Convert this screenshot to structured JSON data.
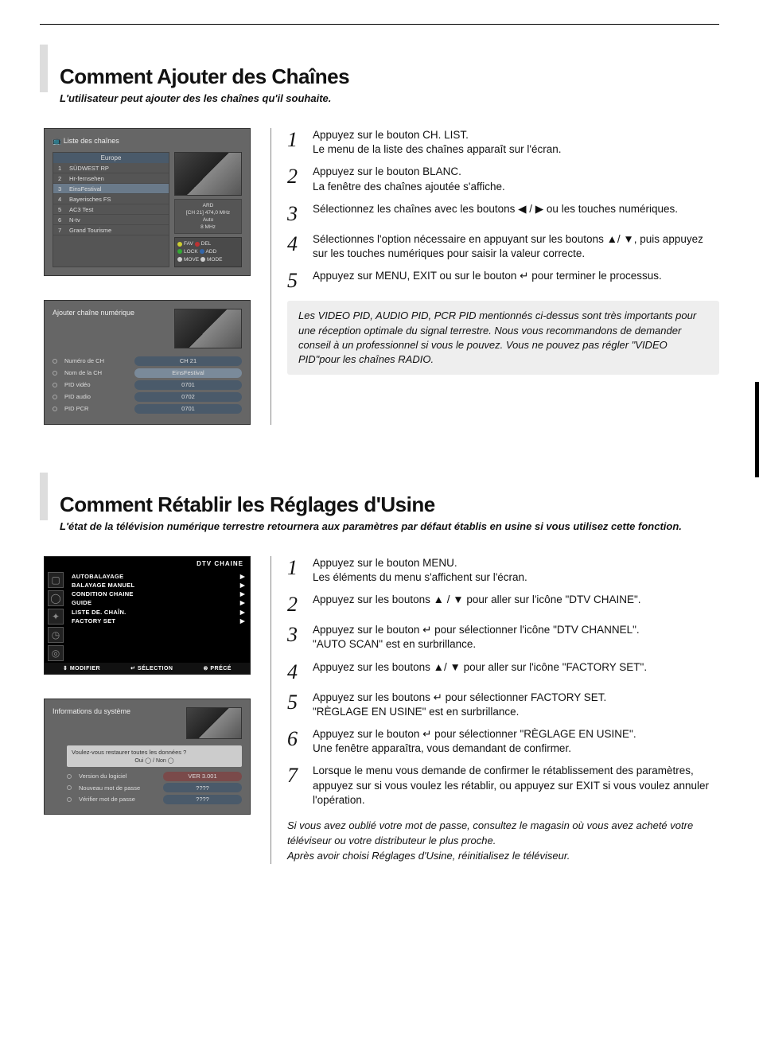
{
  "section1": {
    "title": "Comment Ajouter des Chaînes",
    "subtitle": "L'utilisateur peut ajouter des les chaînes qu'il souhaite.",
    "steps": [
      {
        "n": "1",
        "a": "Appuyez sur le bouton CH. LIST.",
        "b": "Le menu de la liste des chaînes apparaît sur l'écran."
      },
      {
        "n": "2",
        "a": "Appuyez sur le bouton BLANC.",
        "b": "La fenêtre des chaînes ajoutée s'affiche."
      },
      {
        "n": "3",
        "a": "Sélectionnez les chaînes avec les boutons ◀ / ▶ ou les touches numériques."
      },
      {
        "n": "4",
        "a": "Sélectionnes l'option nécessaire en appuyant sur les boutons ▲/ ▼, puis appuyez sur les touches numériques pour saisir la valeur correcte."
      },
      {
        "n": "5",
        "a": "Appuyez sur MENU, EXIT ou sur le bouton ↵ pour terminer le processus."
      }
    ],
    "note": "Les VIDEO PID, AUDIO PID, PCR PID mentionnés ci-dessus sont très importants pour une réception optimale du signal terrestre. Nous vous recommandons de demander conseil à un professionnel si vous le pouvez. Vous ne pouvez pas régler \"VIDEO PID\"pour les chaînes RADIO.",
    "screenshot1": {
      "title": "Liste des chaînes",
      "region": "Europe",
      "channels": [
        {
          "idx": "1",
          "name": "SÜDWEST RP"
        },
        {
          "idx": "2",
          "name": "Hr-fernsehen"
        },
        {
          "idx": "3",
          "name": "EinsFestival"
        },
        {
          "idx": "4",
          "name": "Bayerisches FS"
        },
        {
          "idx": "5",
          "name": "AC3 Test"
        },
        {
          "idx": "6",
          "name": "N-tv"
        },
        {
          "idx": "7",
          "name": "Grand Tourisme"
        }
      ],
      "info": {
        "name": "ARD",
        "ch": "[CH 21] 474,0 MHz",
        "mode": "Auto",
        "bw": "8 MHz"
      },
      "legend": {
        "fav": "FAV",
        "del": "DEL",
        "lock": "LOCK",
        "add": "ADD",
        "move": "MOVE",
        "mode": "MODE"
      }
    },
    "screenshot2": {
      "title": "Ajouter chaîne numérique",
      "fields": [
        {
          "label": "Numéro de CH",
          "value": "CH 21"
        },
        {
          "label": "Nom de la CH",
          "value": "EinsFestival",
          "hl": true
        },
        {
          "label": "PID vidéo",
          "value": "0701"
        },
        {
          "label": "PID audio",
          "value": "0702"
        },
        {
          "label": "PID PCR",
          "value": "0701"
        }
      ]
    }
  },
  "section2": {
    "title": "Comment Rétablir les Réglages d'Usine",
    "subtitle": "L'état de la télévision numérique terrestre retournera aux paramètres par défaut établis en usine si vous utilisez cette fonction.",
    "steps": [
      {
        "n": "1",
        "a": "Appuyez sur le bouton MENU.",
        "b": "Les éléments du menu s'affichent sur l'écran."
      },
      {
        "n": "2",
        "a": "Appuyez sur les boutons ▲ / ▼ pour aller sur l'icône \"DTV CHAINE\"."
      },
      {
        "n": "3",
        "a": "Appuyez sur le bouton ↵ pour sélectionner l'icône \"DTV CHANNEL\".",
        "b": "\"AUTO SCAN\" est en surbrillance."
      },
      {
        "n": "4",
        "a": "Appuyez sur les boutons ▲/ ▼ pour aller sur l'icône \"FACTORY SET\"."
      },
      {
        "n": "5",
        "a": "Appuyez sur les boutons ↵ pour sélectionner FACTORY SET.",
        "b": "\"RÈGLAGE EN USINE\" est en surbrillance."
      },
      {
        "n": "6",
        "a": "Appuyez sur le bouton ↵ pour sélectionner \"RÈGLAGE EN USINE\".",
        "b": "Une fenêtre apparaîtra, vous demandant de confirmer."
      },
      {
        "n": "7",
        "a": "Lorsque le menu vous demande de confirmer le rétablissement des paramètres, appuyez sur  si vous voulez les rétablir, ou appuyez sur EXIT si vous voulez annuler l'opération."
      }
    ],
    "note": "Si vous avez oublié votre mot de passe, consultez le magasin où vous avez acheté votre téléviseur ou votre distributeur le plus proche.\nAprès avoir choisi Réglages d'Usine, réinitialisez le téléviseur.",
    "screenshot3": {
      "head": "DTV CHAINE",
      "items": [
        "AUTOBALAYAGE",
        "BALAYAGE MANUEL",
        "CONDITION CHAINE",
        "GUIDE",
        "LISTE DE. CHAÎN.",
        "FACTORY SET"
      ],
      "footer": {
        "modify": "MODIFIER",
        "select": "SÉLECTION",
        "prev": "PRÉCÉ"
      }
    },
    "screenshot4": {
      "title": "Informations du système",
      "dialog": {
        "msg": "Voulez-vous restaurer toutes les données ?",
        "yes": "Oui",
        "no": "Non"
      },
      "rows": [
        {
          "label": "Version du logiciel",
          "value": "VER 3.001",
          "hl": true
        },
        {
          "label": "Nouveau mot de passe",
          "value": "????"
        },
        {
          "label": "Vérifier mot de passe",
          "value": "????"
        }
      ]
    }
  }
}
